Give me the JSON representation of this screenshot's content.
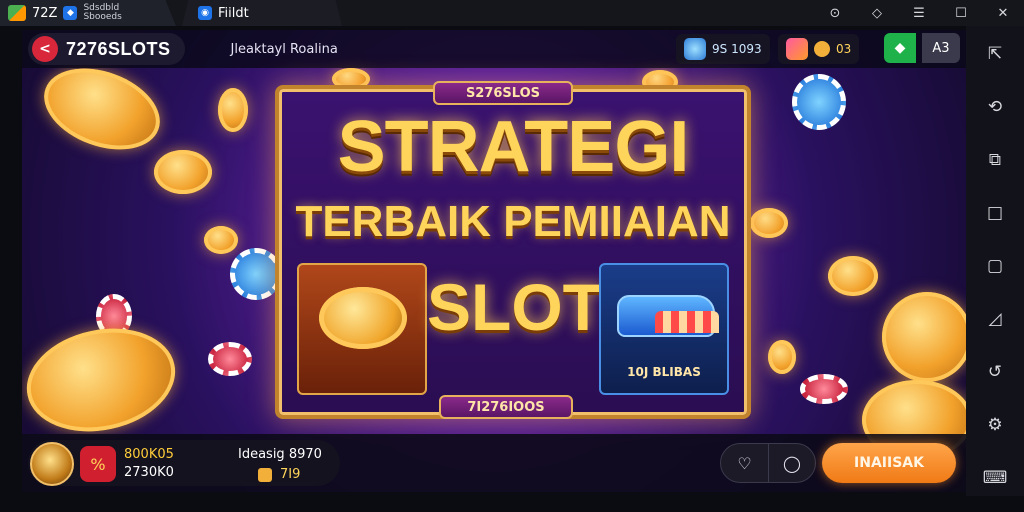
{
  "titlebar": {
    "tab1_title": "72Z",
    "tab1_sub_line1": "Sdsdbld",
    "tab1_sub_line2": "Sbooeds",
    "tab2_title": "Fiildt",
    "controls": [
      "shield-icon",
      "location-icon",
      "menu-icon",
      "maximize-icon",
      "close-icon"
    ]
  },
  "hud_top": {
    "brand": "7276SLOTS",
    "subtitle": "Jleaktayl Roalina",
    "stat_a": "9S 1093",
    "stat_b": "03",
    "ai_label": "A3"
  },
  "banner": {
    "tag_top": "S276SLOS",
    "title_line1": "STRATEGI",
    "title_line2": "TERBAIK PEMIIAIAN",
    "title_line3": "SLOT",
    "prize_label": "10J BLIBAS",
    "tag_bottom": "7I276IOOS"
  },
  "hud_bottom": {
    "coins_line1": "800K05",
    "coins_line2": "2730K0",
    "deposit_label": "Ideasig 8970",
    "deposit_value": "7I9",
    "cta_label": "INAIISAK"
  },
  "sidebar": {
    "icons": [
      "share-icon",
      "rotate-icon",
      "copy-icon",
      "square-icon",
      "square-outline-icon",
      "triangle-icon",
      "refresh-icon",
      "settings-icon",
      "keyboard-icon"
    ]
  },
  "colors": {
    "accent_gold": "#ffd45a",
    "cta_orange": "#f07a16",
    "back_red": "#d8263a",
    "green": "#1fb24a"
  }
}
